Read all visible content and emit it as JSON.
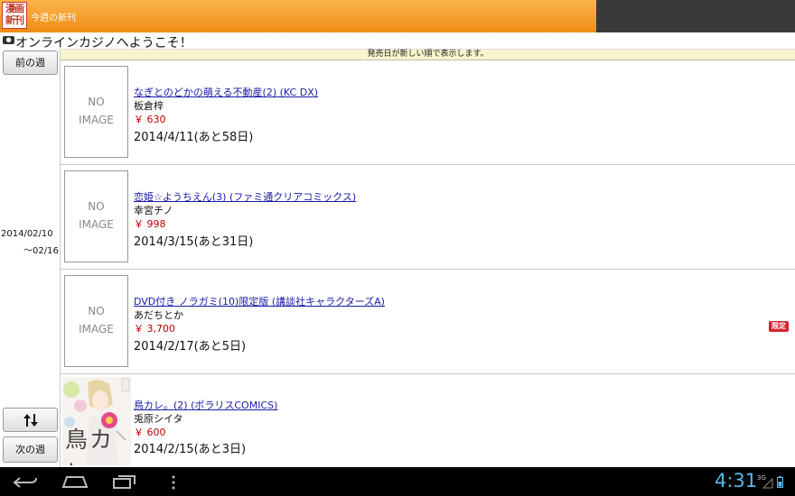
{
  "app": {
    "icon_text": "漫画新刊",
    "title": "今週の新刊"
  },
  "ad": {
    "text": "オンラインカジノへようこそ！"
  },
  "nav": {
    "prev_week": "前の週",
    "next_week": "次の週",
    "sort_icon": "sort-updown-icon",
    "date_from": "2014/02/10",
    "date_to": "〜02/16"
  },
  "notice": "発売日が新しい順で表示します。",
  "placeholder": {
    "line1": "NO",
    "line2": "IMAGE"
  },
  "items": [
    {
      "title": "なぎとのどかの萌える不動産(2) (KC DX)",
      "author": "板倉梓",
      "price": "￥ 630",
      "date": "2014/4/11(あと58日)"
    },
    {
      "title": "恋姫☆ようちえん(3) (ファミ通クリアコミックス)",
      "author": "幸宮チノ",
      "price": "￥ 998",
      "date": "2014/3/15(あと31日)"
    },
    {
      "title": "DVD付き ノラガミ(10)限定版 (講談社キャラクターズA)",
      "author": "あだちとか",
      "price": "￥ 3,700",
      "date": "2014/2/17(あと5日)",
      "badge": "限定"
    },
    {
      "title": "鳥カレ。(2) (ポラリスCOMICS)",
      "author": "兎原シイタ",
      "price": "￥ 600",
      "date": "2014/2/15(あと3日)",
      "cover_text": "鳥カレ"
    }
  ],
  "status": {
    "time": "4:31",
    "network": "3G"
  },
  "colors": {
    "title_bar": "#f08c14",
    "link": "#1a1aa8",
    "price": "#bb0000",
    "clock": "#5ab6e6",
    "badge": "#d8222b",
    "notice_bg": "#f8f5cc"
  }
}
